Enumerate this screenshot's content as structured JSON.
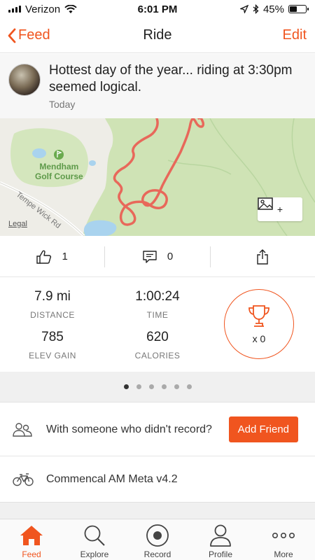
{
  "status_bar": {
    "carrier": "Verizon",
    "time": "6:01 PM",
    "battery": "45%",
    "battery_level": 0.45
  },
  "nav": {
    "back_label": "Feed",
    "title": "Ride",
    "edit_label": "Edit"
  },
  "activity": {
    "title": "Hottest day of the year... riding at 3:30pm seemed logical.",
    "date": "Today"
  },
  "map": {
    "place_label": "Mendham\nGolf Course",
    "road_label": "Tempe Wick Rd",
    "legal_label": "Legal",
    "photo_button_plus": "+",
    "colors": {
      "route": "#e8685a",
      "park": "#cfe3b5",
      "water": "#a9d3ee",
      "land": "#eeede7"
    }
  },
  "actions": {
    "kudos_count": "1",
    "comments_count": "0"
  },
  "stats": {
    "distance_value": "7.9 mi",
    "distance_label": "DISTANCE",
    "time_value": "1:00:24",
    "time_label": "TIME",
    "elev_value": "785",
    "elev_label": "ELEV GAIN",
    "calories_value": "620",
    "calories_label": "CALORIES",
    "trophy_count": "x 0"
  },
  "pager": {
    "pages": 6,
    "active_index": 0
  },
  "friend_row": {
    "text": "With someone who didn't record?",
    "button_label": "Add Friend"
  },
  "bike_row": {
    "text": "Commencal AM Meta v4.2"
  },
  "tab_bar": {
    "tabs": [
      {
        "label": "Feed",
        "icon": "home-icon",
        "active": true
      },
      {
        "label": "Explore",
        "icon": "search-icon",
        "active": false
      },
      {
        "label": "Record",
        "icon": "record-icon",
        "active": false
      },
      {
        "label": "Profile",
        "icon": "person-icon",
        "active": false
      },
      {
        "label": "More",
        "icon": "ellipsis-icon",
        "active": false
      }
    ]
  },
  "colors": {
    "accent": "#f0551f"
  }
}
